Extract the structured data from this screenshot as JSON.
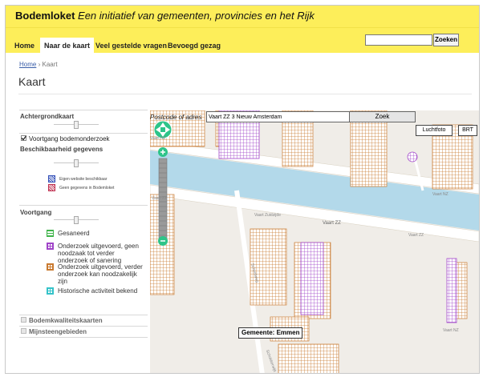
{
  "banner": {
    "brand": "Bodemloket",
    "tagline": "Een initiatief van gemeenten, provincies en het Rijk"
  },
  "nav": {
    "items": [
      "Home",
      "Naar de kaart",
      "Veel gestelde vragen",
      "Bevoegd gezag"
    ],
    "active": "Naar de kaart"
  },
  "search": {
    "value": "",
    "button_label": "Zoeken"
  },
  "breadcrumb": {
    "home": "Home",
    "separator": "›",
    "current": "Kaart"
  },
  "page_title": "Kaart",
  "sidebar": {
    "achtergrondkaart": "Achtergrondkaart",
    "voortgang_check": "Voortgang bodemonderzoek",
    "beschikbaarheid": "Beschikbaarheid gegevens",
    "beschik_items": [
      "Eigen website beschikbaar",
      "Geen gegevens in Bodemloket"
    ],
    "voortgang": "Voortgang",
    "voortgang_items": [
      "Gesaneerd",
      "Onderzoek uitgevoerd, geen noodzaak tot verder onderzoek of sanering",
      "Onderzoek uitgevoerd, verder onderzoek kan noodzakelijk zijn",
      "Historische activiteit bekend"
    ],
    "bodemkwaliteit": "Bodemkwaliteitskaarten",
    "mijnsteen": "Mijnsteengebieden"
  },
  "map": {
    "address_label": "Postcode of adres",
    "address_value": "Vaart ZZ 3 Nieuw Amsterdam",
    "zoek_label": "Zoek",
    "luchtfoto": "Luchtfoto",
    "brt": "BRT",
    "gemeente": "Gemeente: Emmen",
    "streets": [
      "Vaart ZZ",
      "Vaart NZ",
      "Vaart Zuidzijde",
      "Vaart ZZ",
      "Vaart ZZ",
      "Scheidweg",
      "Vaart NZ",
      "Schokkerwijk",
      "Vaart NZ"
    ]
  },
  "colors": {
    "banner": "#fdee5a",
    "canal": "#b3d9ea",
    "orange": "#c97a30",
    "purple": "#a044c8",
    "green": "#3fb34a",
    "cyan": "#35c3c9",
    "zoom": "#2ec489"
  },
  "icons": [
    "pan-up-icon",
    "pan-down-icon",
    "pan-left-icon",
    "pan-right-icon",
    "zoom-in-icon",
    "zoom-out-icon"
  ]
}
